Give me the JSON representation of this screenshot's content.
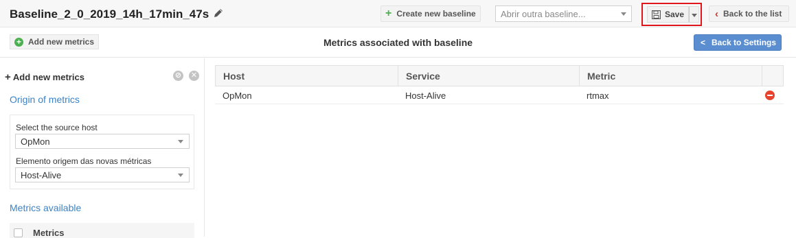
{
  "header": {
    "title": "Baseline_2_0_2019_14h_17min_47s",
    "create_label": "Create new baseline",
    "select_placeholder": "Abrir outra baseline...",
    "save_label": "Save",
    "back_list_label": "Back to the list"
  },
  "subbar": {
    "add_metrics_label": "Add new metrics",
    "center_title": "Metrics associated with baseline",
    "back_settings_label": "Back to Settings"
  },
  "left_panel": {
    "heading": "Add new metrics",
    "origin_title": "Origin of metrics",
    "source_host_label": "Select the source host",
    "source_host_value": "OpMon",
    "element_label": "Elemento origem das novas métricas",
    "element_value": "Host-Alive",
    "available_title": "Metrics available",
    "metrics_column": "Metrics"
  },
  "table": {
    "columns": [
      "Host",
      "Service",
      "Metric"
    ],
    "rows": [
      {
        "host": "OpMon",
        "service": "Host-Alive",
        "metric": "rtmax"
      }
    ]
  },
  "colors": {
    "accent_blue": "#5b8ed0",
    "link_blue": "#3c83c5",
    "highlight_red": "#e0141b",
    "remove_red": "#e8432e",
    "add_green": "#4caf50"
  }
}
